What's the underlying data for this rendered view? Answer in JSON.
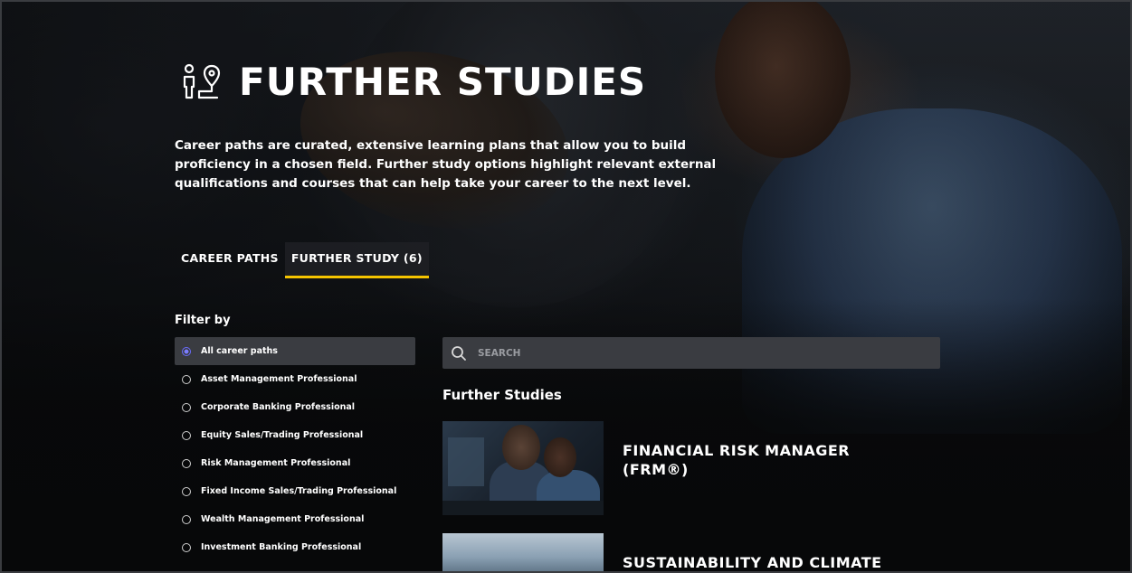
{
  "header": {
    "title": "FURTHER STUDIES",
    "icon": "career-path-icon",
    "intro": "Career paths are curated, extensive learning plans that allow you to build proficiency in a chosen field. Further study options highlight relevant external qualifications and courses that can help take your career to the next level."
  },
  "tabs": [
    {
      "label": "CAREER PATHS",
      "active": false
    },
    {
      "label": "FURTHER STUDY (6)",
      "active": true
    }
  ],
  "filter": {
    "title": "Filter by",
    "options": [
      {
        "label": "All career paths",
        "selected": true
      },
      {
        "label": "Asset Management Professional",
        "selected": false
      },
      {
        "label": "Corporate Banking Professional",
        "selected": false
      },
      {
        "label": "Equity Sales/Trading Professional",
        "selected": false
      },
      {
        "label": "Risk Management Professional",
        "selected": false
      },
      {
        "label": "Fixed Income Sales/Trading Professional",
        "selected": false
      },
      {
        "label": "Wealth Management Professional",
        "selected": false
      },
      {
        "label": "Investment Banking Professional",
        "selected": false
      }
    ]
  },
  "search": {
    "placeholder": "SEARCH",
    "value": ""
  },
  "results": {
    "title": "Further Studies",
    "items": [
      {
        "title": "FINANCIAL RISK MANAGER (FRM®)"
      },
      {
        "title": "SUSTAINABILITY AND CLIMATE"
      }
    ]
  },
  "colors": {
    "accent": "#f5c400",
    "radio_selected": "#6a6cff",
    "panel": "#3a3c41",
    "background": "#0b0d10"
  }
}
